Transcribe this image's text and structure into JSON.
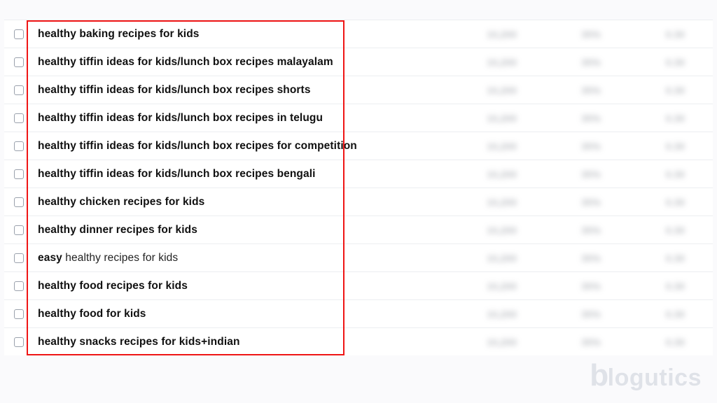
{
  "keywords": [
    {
      "segments": [
        {
          "bold": true,
          "text": "healthy baking recipes for kids"
        }
      ]
    },
    {
      "segments": [
        {
          "bold": true,
          "text": "healthy tiffin ideas for kids/lunch box recipes malayalam"
        }
      ]
    },
    {
      "segments": [
        {
          "bold": true,
          "text": "healthy tiffin ideas for kids/lunch box recipes shorts"
        }
      ]
    },
    {
      "segments": [
        {
          "bold": true,
          "text": "healthy tiffin ideas for kids/lunch box recipes in telugu"
        }
      ]
    },
    {
      "segments": [
        {
          "bold": true,
          "text": "healthy tiffin ideas for kids/lunch box recipes for competition"
        }
      ]
    },
    {
      "segments": [
        {
          "bold": true,
          "text": "healthy tiffin ideas for kids/lunch box recipes bengali"
        }
      ]
    },
    {
      "segments": [
        {
          "bold": true,
          "text": "healthy chicken recipes for kids"
        }
      ]
    },
    {
      "segments": [
        {
          "bold": true,
          "text": "healthy dinner recipes for kids"
        }
      ]
    },
    {
      "segments": [
        {
          "bold": true,
          "text": "easy"
        },
        {
          "bold": false,
          "text": " healthy recipes for kids"
        }
      ]
    },
    {
      "segments": [
        {
          "bold": true,
          "text": "healthy food recipes for kids"
        }
      ]
    },
    {
      "segments": [
        {
          "bold": true,
          "text": "healthy food for kids"
        }
      ]
    },
    {
      "segments": [
        {
          "bold": true,
          "text": "healthy snacks recipes for kids+indian"
        }
      ]
    }
  ],
  "metrics_placeholder": {
    "m1": "10,200",
    "m2": "35%",
    "m3": "0.30"
  },
  "watermark": {
    "brand_prefix": "b",
    "brand_rest": "logutics"
  }
}
